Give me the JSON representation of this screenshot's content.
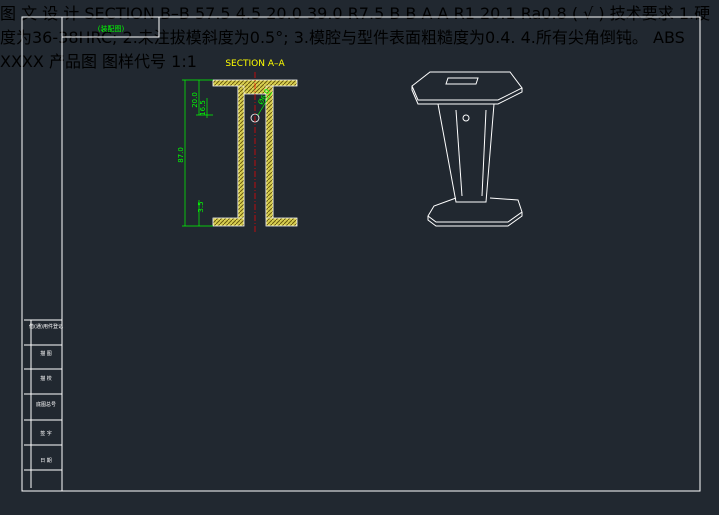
{
  "drawing": {
    "corner_tag": "(装配图)",
    "section_aa_title": "SECTION A–A",
    "section_bb_title": "SECTION B–B",
    "watermark": "图 文 设 计",
    "dims_aa": [
      "20.0",
      "16.5",
      "Ø6.0",
      "87.0",
      "3.5"
    ],
    "dims_top": [
      "57.5",
      "4.5",
      "20.0",
      "39.0",
      "R7.5"
    ],
    "dims_bb": [
      "R1",
      "20.1"
    ],
    "section_markers": [
      "B",
      "B",
      "A",
      "A"
    ],
    "roughness": "Ra0.8",
    "roughness_mark": "( √ )",
    "tech_title": "技术要求",
    "tech_notes": [
      "1.硬度为36-38HRC;",
      "2.未注拔模斜度为0.5°;",
      "3.模腔与型件表面粗糙度为0.4.",
      "4.所有尖角倒钝。"
    ],
    "left_labels": [
      "借(通)用件登记",
      "描 图",
      "描 校",
      "底图总号",
      "签 字",
      "日 期"
    ]
  },
  "title_block": {
    "material": "ABS",
    "part_name": "XXXX",
    "label_product": "产品图",
    "label_code": "图样代号",
    "scale": "1:1"
  },
  "colors": {
    "background": "#212830",
    "frame": "#ffffff",
    "title_dims": "#ffff00",
    "dims": "#00ff00",
    "centerline": "#ff0000",
    "part_name": "#3030ff"
  }
}
